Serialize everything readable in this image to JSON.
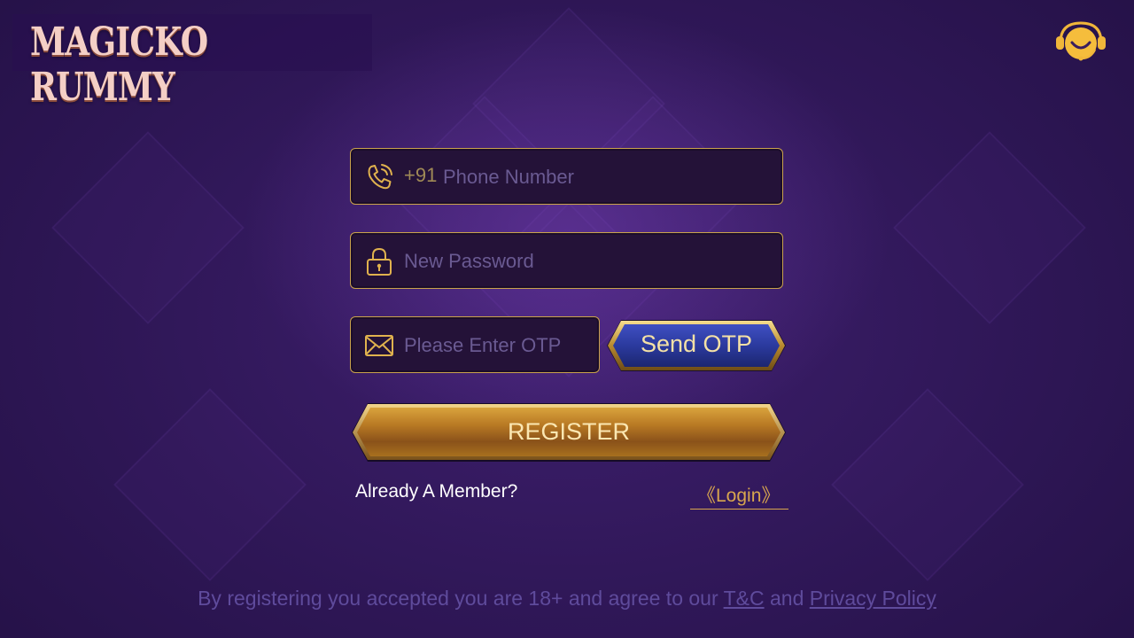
{
  "app": {
    "logo_text": "MAGICKO RUMMY"
  },
  "header": {
    "support_icon": "support-agent-icon"
  },
  "form": {
    "phone": {
      "prefix": "+91",
      "placeholder": "Phone Number",
      "value": "",
      "icon": "phone-icon"
    },
    "password": {
      "placeholder": "New Password",
      "value": "",
      "icon": "lock-icon"
    },
    "otp": {
      "placeholder": "Please Enter OTP",
      "value": "",
      "icon": "mail-icon"
    },
    "send_otp_label": "Send OTP",
    "register_label": "REGISTER",
    "member_text": "Already A Member?",
    "login_link": "《Login》"
  },
  "footer": {
    "text_before": "By registering you accepted you are 18+ and agree to our ",
    "tc_link": "T&C",
    "text_and": " and ",
    "privacy_link": "Privacy Policy"
  },
  "colors": {
    "accent_gold": "#c9a24c",
    "register_gold": "#b67a22",
    "otp_blue": "#2c3a9e",
    "background": "#2f1757"
  }
}
